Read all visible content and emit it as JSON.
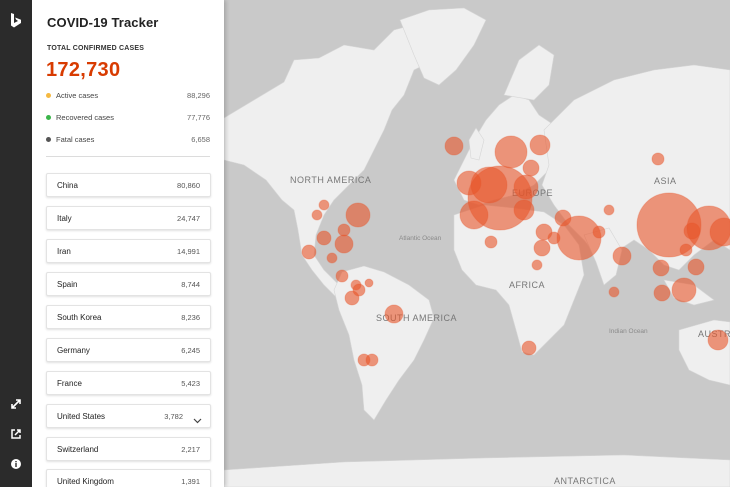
{
  "app": {
    "title": "COVID-19 Tracker"
  },
  "summary": {
    "total_label": "TOTAL CONFIRMED CASES",
    "total_value": "172,730",
    "stats": [
      {
        "label": "Active cases",
        "value": "88,296",
        "color": "#f5b941"
      },
      {
        "label": "Recovered cases",
        "value": "77,776",
        "color": "#3bb54a"
      },
      {
        "label": "Fatal cases",
        "value": "6,658",
        "color": "#555555"
      }
    ]
  },
  "countries": [
    {
      "name": "China",
      "value": "80,860"
    },
    {
      "name": "Italy",
      "value": "24,747"
    },
    {
      "name": "Iran",
      "value": "14,991"
    },
    {
      "name": "Spain",
      "value": "8,744"
    },
    {
      "name": "South Korea",
      "value": "8,236"
    },
    {
      "name": "Germany",
      "value": "6,245"
    },
    {
      "name": "France",
      "value": "5,423"
    },
    {
      "name": "United States",
      "value": "3,782",
      "expandable": true
    },
    {
      "name": "Switzerland",
      "value": "2,217"
    },
    {
      "name": "United Kingdom",
      "value": "1,391"
    }
  ],
  "map": {
    "labels": [
      "NORTH AMERICA",
      "SOUTH AMERICA",
      "AFRICA",
      "EUROPE",
      "ASIA",
      "AUSTRALIA",
      "ANTARCTICA",
      "Atlantic Ocean",
      "Indian Ocean"
    ],
    "bubble_color": "#e8552a",
    "water_color": "#c9c9c9",
    "land_color": "#efefef"
  },
  "rail": {
    "icons": [
      "bing-logo-icon",
      "expand-icon",
      "share-icon",
      "info-icon"
    ]
  }
}
